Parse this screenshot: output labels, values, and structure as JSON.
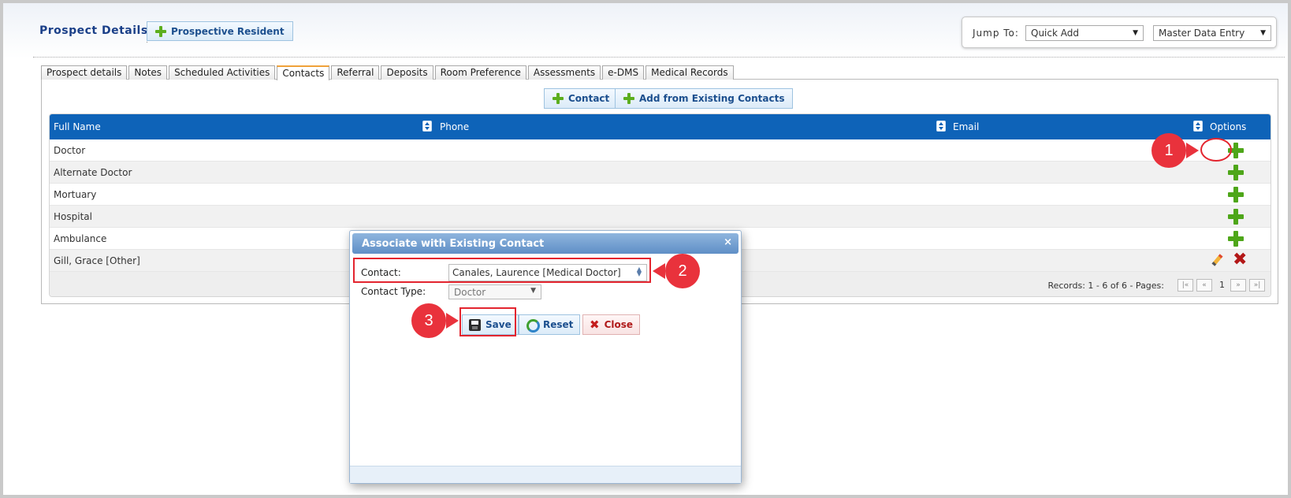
{
  "header": {
    "title": "Prospect Details",
    "prospective_resident_label": "Prospective Resident",
    "jump_to_label": "Jump To:",
    "quick_add_value": "Quick Add",
    "master_data_value": "Master Data Entry"
  },
  "tabs": [
    {
      "label": "Prospect details",
      "active": false
    },
    {
      "label": "Notes",
      "active": false
    },
    {
      "label": "Scheduled Activities",
      "active": false
    },
    {
      "label": "Contacts",
      "active": true
    },
    {
      "label": "Referral",
      "active": false
    },
    {
      "label": "Deposits",
      "active": false
    },
    {
      "label": "Room Preference",
      "active": false
    },
    {
      "label": "Assessments",
      "active": false
    },
    {
      "label": "e-DMS",
      "active": false
    },
    {
      "label": "Medical Records",
      "active": false
    }
  ],
  "toolbar": {
    "contact_label": "Contact",
    "add_existing_label": "Add from Existing Contacts"
  },
  "grid": {
    "columns": [
      "Full Name",
      "Phone",
      "Email",
      "Options"
    ],
    "rows": [
      {
        "name": "Doctor",
        "phone": "",
        "email": ""
      },
      {
        "name": "Alternate Doctor",
        "phone": "",
        "email": ""
      },
      {
        "name": "Mortuary",
        "phone": "",
        "email": ""
      },
      {
        "name": "Hospital",
        "phone": "",
        "email": ""
      },
      {
        "name": "Ambulance",
        "phone": "",
        "email": ""
      },
      {
        "name": "Gill, Grace [Other]",
        "phone": "",
        "email": ""
      }
    ],
    "records_text": "Records: 1 - 6 of 6 - Pages:",
    "current_page": "1"
  },
  "dialog": {
    "title": "Associate with Existing Contact",
    "close_glyph": "×",
    "contact_label": "Contact:",
    "contact_value": "Canales, Laurence [Medical Doctor]",
    "contact_type_label": "Contact Type:",
    "contact_type_value": "Doctor",
    "save_label": "Save",
    "reset_label": "Reset",
    "close_label": "Close"
  },
  "callouts": {
    "one": "1",
    "two": "2",
    "three": "3"
  },
  "colors": {
    "grid_header": "#0e63b8",
    "accent_red": "#e9323c",
    "plus_green": "#4ea619",
    "tab_active_border": "#f0a23a"
  }
}
